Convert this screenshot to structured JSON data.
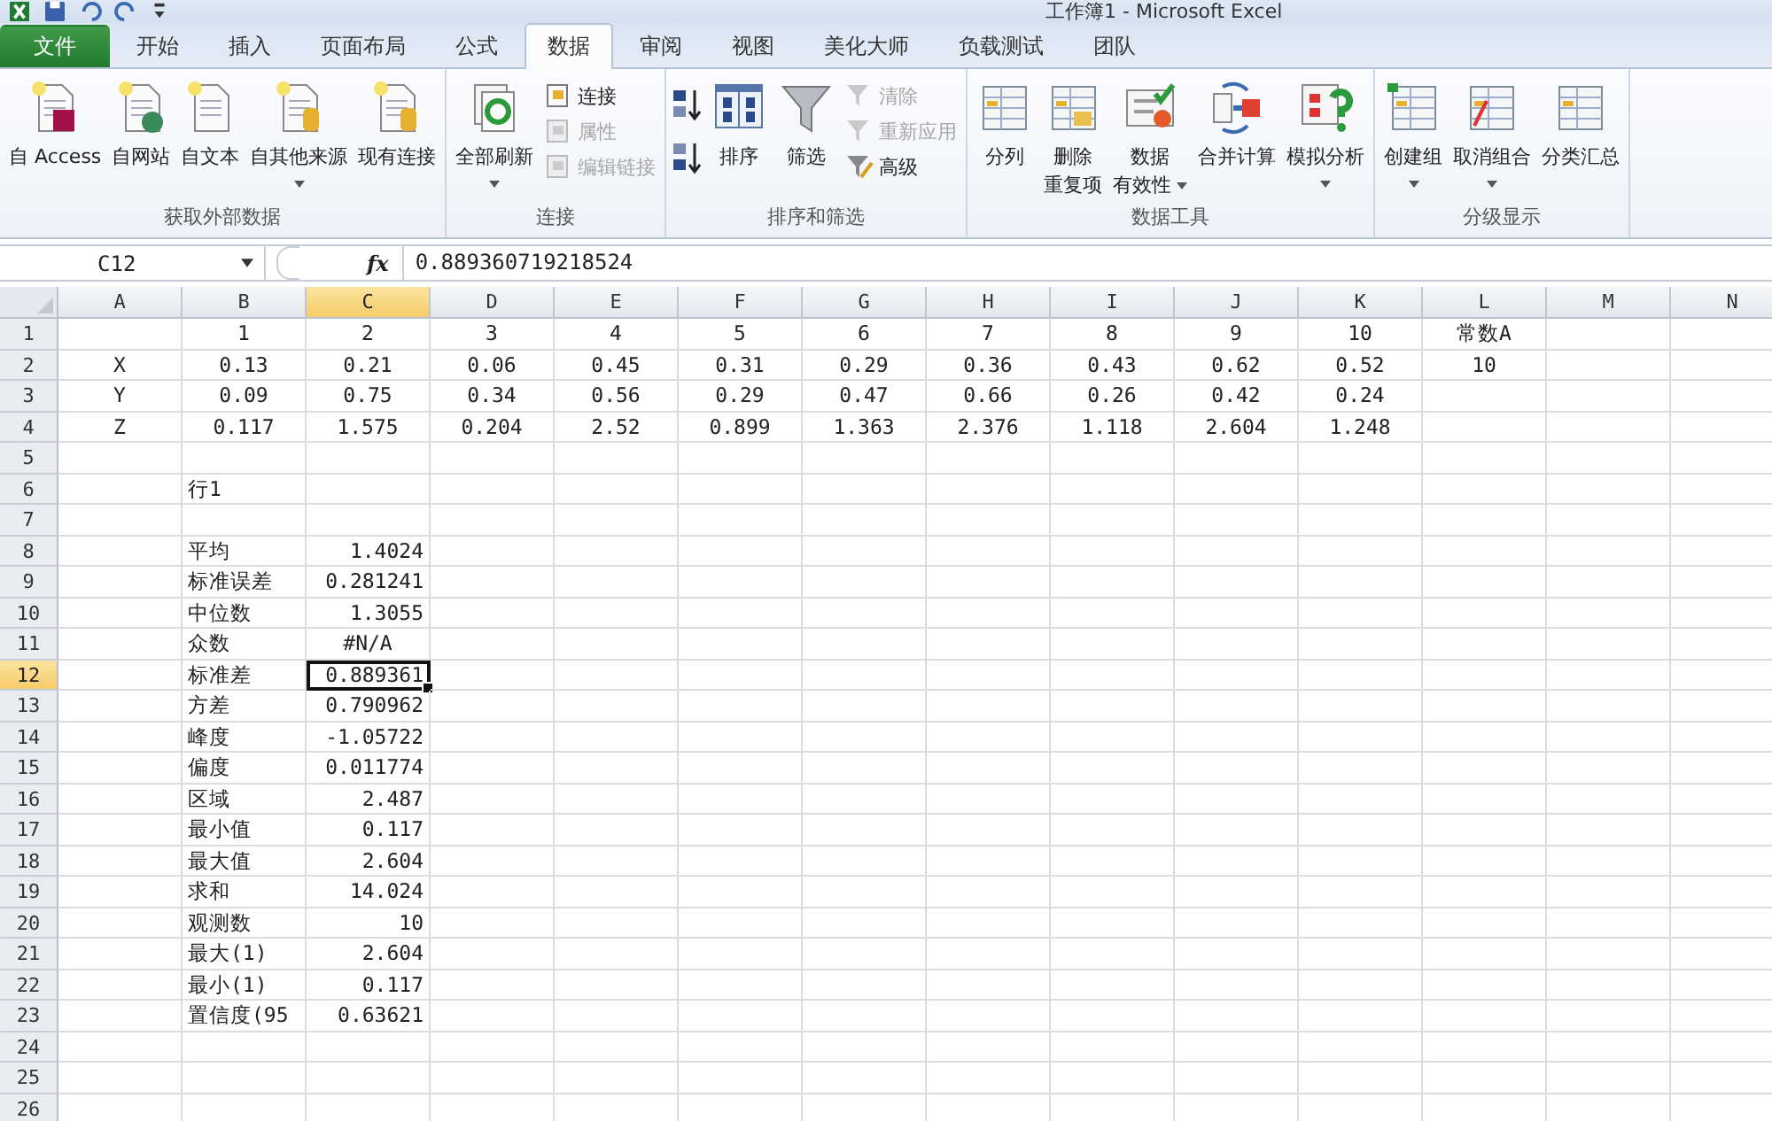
{
  "window": {
    "title": "工作簿1 - Microsoft Excel"
  },
  "tabs": [
    {
      "label": "文件",
      "kind": "file",
      "selected": false
    },
    {
      "label": "开始",
      "kind": "tab",
      "selected": false
    },
    {
      "label": "插入",
      "kind": "tab",
      "selected": false
    },
    {
      "label": "页面布局",
      "kind": "tab",
      "selected": false
    },
    {
      "label": "公式",
      "kind": "tab",
      "selected": false
    },
    {
      "label": "数据",
      "kind": "tab",
      "selected": true
    },
    {
      "label": "审阅",
      "kind": "tab",
      "selected": false
    },
    {
      "label": "视图",
      "kind": "tab",
      "selected": false
    },
    {
      "label": "美化大师",
      "kind": "tab",
      "selected": false
    },
    {
      "label": "负载测试",
      "kind": "tab",
      "selected": false
    },
    {
      "label": "团队",
      "kind": "tab",
      "selected": false
    }
  ],
  "ribbon": {
    "groups": [
      {
        "label": "获取外部数据",
        "items": [
          {
            "kind": "large",
            "label": "自 Access",
            "dropdown": false
          },
          {
            "kind": "large",
            "label": "自网站",
            "dropdown": false
          },
          {
            "kind": "large",
            "label": "自文本",
            "dropdown": false
          },
          {
            "kind": "large",
            "label": "自其他来源",
            "dropdown": true
          },
          {
            "kind": "large",
            "label": "现有连接",
            "dropdown": false
          }
        ]
      },
      {
        "label": "连接",
        "items": [
          {
            "kind": "large",
            "label": "全部刷新",
            "dropdown": true
          },
          {
            "kind": "stack",
            "buttons": [
              {
                "label": "连接",
                "disabled": false
              },
              {
                "label": "属性",
                "disabled": true
              },
              {
                "label": "编辑链接",
                "disabled": true
              }
            ]
          }
        ]
      },
      {
        "label": "排序和筛选",
        "items": [
          {
            "kind": "sort-pair"
          },
          {
            "kind": "large",
            "label": "排序",
            "dropdown": false
          },
          {
            "kind": "large",
            "label": "筛选",
            "dropdown": false
          },
          {
            "kind": "stack",
            "buttons": [
              {
                "label": "清除",
                "disabled": true
              },
              {
                "label": "重新应用",
                "disabled": true
              },
              {
                "label": "高级",
                "disabled": false
              }
            ]
          }
        ]
      },
      {
        "label": "数据工具",
        "items": [
          {
            "kind": "large",
            "label": "分列",
            "dropdown": false
          },
          {
            "kind": "large",
            "lines": [
              "删除",
              "重复项"
            ],
            "dropdown": false
          },
          {
            "kind": "large",
            "lines": [
              "数据",
              "有效性"
            ],
            "dropdown": true
          },
          {
            "kind": "large",
            "label": "合并计算",
            "dropdown": false
          },
          {
            "kind": "large",
            "label": "模拟分析",
            "dropdown": true
          }
        ]
      },
      {
        "label": "分级显示",
        "items": [
          {
            "kind": "large",
            "label": "创建组",
            "dropdown": true
          },
          {
            "kind": "large",
            "label": "取消组合",
            "dropdown": true
          },
          {
            "kind": "large",
            "label": "分类汇总",
            "dropdown": false
          }
        ]
      }
    ]
  },
  "formula_bar": {
    "name_box": "C12",
    "fx": "fx",
    "formula": "0.889360719218524"
  },
  "sheet": {
    "columns": [
      {
        "label": "A",
        "selected": false
      },
      {
        "label": "B",
        "selected": false
      },
      {
        "label": "C",
        "selected": true
      },
      {
        "label": "D",
        "selected": false
      },
      {
        "label": "E",
        "selected": false
      },
      {
        "label": "F",
        "selected": false
      },
      {
        "label": "G",
        "selected": false
      },
      {
        "label": "H",
        "selected": false
      },
      {
        "label": "I",
        "selected": false
      },
      {
        "label": "J",
        "selected": false
      },
      {
        "label": "K",
        "selected": false
      },
      {
        "label": "L",
        "selected": false
      },
      {
        "label": "M",
        "selected": false
      },
      {
        "label": "N",
        "selected": false
      }
    ],
    "rows": [
      {
        "n": "1",
        "selected": false,
        "cells": [
          null,
          {
            "text": "1",
            "kind": "table",
            "selected": false
          },
          {
            "text": "2",
            "kind": "table",
            "selected": false
          },
          {
            "text": "3",
            "kind": "table",
            "selected": false
          },
          {
            "text": "4",
            "kind": "table",
            "selected": false
          },
          {
            "text": "5",
            "kind": "table",
            "selected": false
          },
          {
            "text": "6",
            "kind": "table",
            "selected": false
          },
          {
            "text": "7",
            "kind": "table",
            "selected": false
          },
          {
            "text": "8",
            "kind": "table",
            "selected": false
          },
          {
            "text": "9",
            "kind": "table",
            "selected": false
          },
          {
            "text": "10",
            "kind": "table",
            "selected": false
          },
          {
            "text": "常数A",
            "kind": "table",
            "selected": false
          }
        ]
      },
      {
        "n": "2",
        "selected": false,
        "cells": [
          {
            "text": "X",
            "kind": "table",
            "selected": false
          },
          {
            "text": "0.13",
            "kind": "table",
            "selected": false
          },
          {
            "text": "0.21",
            "kind": "table",
            "selected": false
          },
          {
            "text": "0.06",
            "kind": "table",
            "selected": false
          },
          {
            "text": "0.45",
            "kind": "table",
            "selected": false
          },
          {
            "text": "0.31",
            "kind": "table",
            "selected": false
          },
          {
            "text": "0.29",
            "kind": "table",
            "selected": false
          },
          {
            "text": "0.36",
            "kind": "table",
            "selected": false
          },
          {
            "text": "0.43",
            "kind": "table",
            "selected": false
          },
          {
            "text": "0.62",
            "kind": "table",
            "selected": false
          },
          {
            "text": "0.52",
            "kind": "table",
            "selected": false
          },
          {
            "text": "10",
            "kind": "table",
            "selected": false
          }
        ]
      },
      {
        "n": "3",
        "selected": false,
        "cells": [
          {
            "text": "Y",
            "kind": "table",
            "selected": false
          },
          {
            "text": "0.09",
            "kind": "table",
            "selected": false
          },
          {
            "text": "0.75",
            "kind": "table",
            "selected": false
          },
          {
            "text": "0.34",
            "kind": "table",
            "selected": false
          },
          {
            "text": "0.56",
            "kind": "table",
            "selected": false
          },
          {
            "text": "0.29",
            "kind": "table",
            "selected": false
          },
          {
            "text": "0.47",
            "kind": "table",
            "selected": false
          },
          {
            "text": "0.66",
            "kind": "table",
            "selected": false
          },
          {
            "text": "0.26",
            "kind": "table",
            "selected": false
          },
          {
            "text": "0.42",
            "kind": "table",
            "selected": false
          },
          {
            "text": "0.24",
            "kind": "table",
            "selected": false
          }
        ]
      },
      {
        "n": "4",
        "selected": false,
        "cells": [
          {
            "text": "Z",
            "kind": "table",
            "selected": false
          },
          {
            "text": "0.117",
            "kind": "table",
            "selected": false
          },
          {
            "text": "1.575",
            "kind": "table",
            "selected": false
          },
          {
            "text": "0.204",
            "kind": "table",
            "selected": false
          },
          {
            "text": "2.52",
            "kind": "table",
            "selected": false
          },
          {
            "text": "0.899",
            "kind": "table",
            "selected": false
          },
          {
            "text": "1.363",
            "kind": "table",
            "selected": false
          },
          {
            "text": "2.376",
            "kind": "table",
            "selected": false
          },
          {
            "text": "1.118",
            "kind": "table",
            "selected": false
          },
          {
            "text": "2.604",
            "kind": "table",
            "selected": false
          },
          {
            "text": "1.248",
            "kind": "table",
            "selected": false
          }
        ]
      },
      {
        "n": "5",
        "selected": false,
        "cells": []
      },
      {
        "n": "6",
        "selected": false,
        "cells": [
          null,
          {
            "text": "行1",
            "kind": "label",
            "selected": false
          }
        ]
      },
      {
        "n": "7",
        "selected": false,
        "cells": []
      },
      {
        "n": "8",
        "selected": false,
        "cells": [
          null,
          {
            "text": "平均",
            "kind": "label",
            "selected": false
          },
          {
            "text": "1.4024",
            "kind": "number",
            "selected": false
          }
        ]
      },
      {
        "n": "9",
        "selected": false,
        "cells": [
          null,
          {
            "text": "标准误差",
            "kind": "label",
            "selected": false
          },
          {
            "text": "0.281241",
            "kind": "number",
            "selected": false
          }
        ]
      },
      {
        "n": "10",
        "selected": false,
        "cells": [
          null,
          {
            "text": "中位数",
            "kind": "label",
            "selected": false
          },
          {
            "text": "1.3055",
            "kind": "number",
            "selected": false
          }
        ]
      },
      {
        "n": "11",
        "selected": false,
        "cells": [
          null,
          {
            "text": "众数",
            "kind": "label",
            "selected": false
          },
          {
            "text": "#N/A",
            "kind": "error",
            "selected": false
          }
        ]
      },
      {
        "n": "12",
        "selected": true,
        "cells": [
          null,
          {
            "text": "标准差",
            "kind": "label",
            "selected": false
          },
          {
            "text": "0.889361",
            "kind": "number",
            "selected": true
          }
        ]
      },
      {
        "n": "13",
        "selected": false,
        "cells": [
          null,
          {
            "text": "方差",
            "kind": "label",
            "selected": false
          },
          {
            "text": "0.790962",
            "kind": "number",
            "selected": false
          }
        ]
      },
      {
        "n": "14",
        "selected": false,
        "cells": [
          null,
          {
            "text": "峰度",
            "kind": "label",
            "selected": false
          },
          {
            "text": "-1.05722",
            "kind": "number",
            "selected": false
          }
        ]
      },
      {
        "n": "15",
        "selected": false,
        "cells": [
          null,
          {
            "text": "偏度",
            "kind": "label",
            "selected": false
          },
          {
            "text": "0.011774",
            "kind": "number",
            "selected": false
          }
        ]
      },
      {
        "n": "16",
        "selected": false,
        "cells": [
          null,
          {
            "text": "区域",
            "kind": "label",
            "selected": false
          },
          {
            "text": "2.487",
            "kind": "number",
            "selected": false
          }
        ]
      },
      {
        "n": "17",
        "selected": false,
        "cells": [
          null,
          {
            "text": "最小值",
            "kind": "label",
            "selected": false
          },
          {
            "text": "0.117",
            "kind": "number",
            "selected": false
          }
        ]
      },
      {
        "n": "18",
        "selected": false,
        "cells": [
          null,
          {
            "text": "最大值",
            "kind": "label",
            "selected": false
          },
          {
            "text": "2.604",
            "kind": "number",
            "selected": false
          }
        ]
      },
      {
        "n": "19",
        "selected": false,
        "cells": [
          null,
          {
            "text": "求和",
            "kind": "label",
            "selected": false
          },
          {
            "text": "14.024",
            "kind": "number",
            "selected": false
          }
        ]
      },
      {
        "n": "20",
        "selected": false,
        "cells": [
          null,
          {
            "text": "观测数",
            "kind": "label",
            "selected": false
          },
          {
            "text": "10",
            "kind": "number",
            "selected": false
          }
        ]
      },
      {
        "n": "21",
        "selected": false,
        "cells": [
          null,
          {
            "text": "最大(1)",
            "kind": "label",
            "selected": false
          },
          {
            "text": "2.604",
            "kind": "number",
            "selected": false
          }
        ]
      },
      {
        "n": "22",
        "selected": false,
        "cells": [
          null,
          {
            "text": "最小(1)",
            "kind": "label",
            "selected": false
          },
          {
            "text": "0.117",
            "kind": "number",
            "selected": false
          }
        ]
      },
      {
        "n": "23",
        "selected": false,
        "cells": [
          null,
          {
            "text": "置信度(95",
            "kind": "label",
            "selected": false
          },
          {
            "text": "0.63621",
            "kind": "number",
            "selected": false
          }
        ]
      },
      {
        "n": "24",
        "selected": false,
        "cells": []
      },
      {
        "n": "25",
        "selected": false,
        "cells": []
      },
      {
        "n": "26",
        "selected": false,
        "cells": []
      }
    ]
  }
}
